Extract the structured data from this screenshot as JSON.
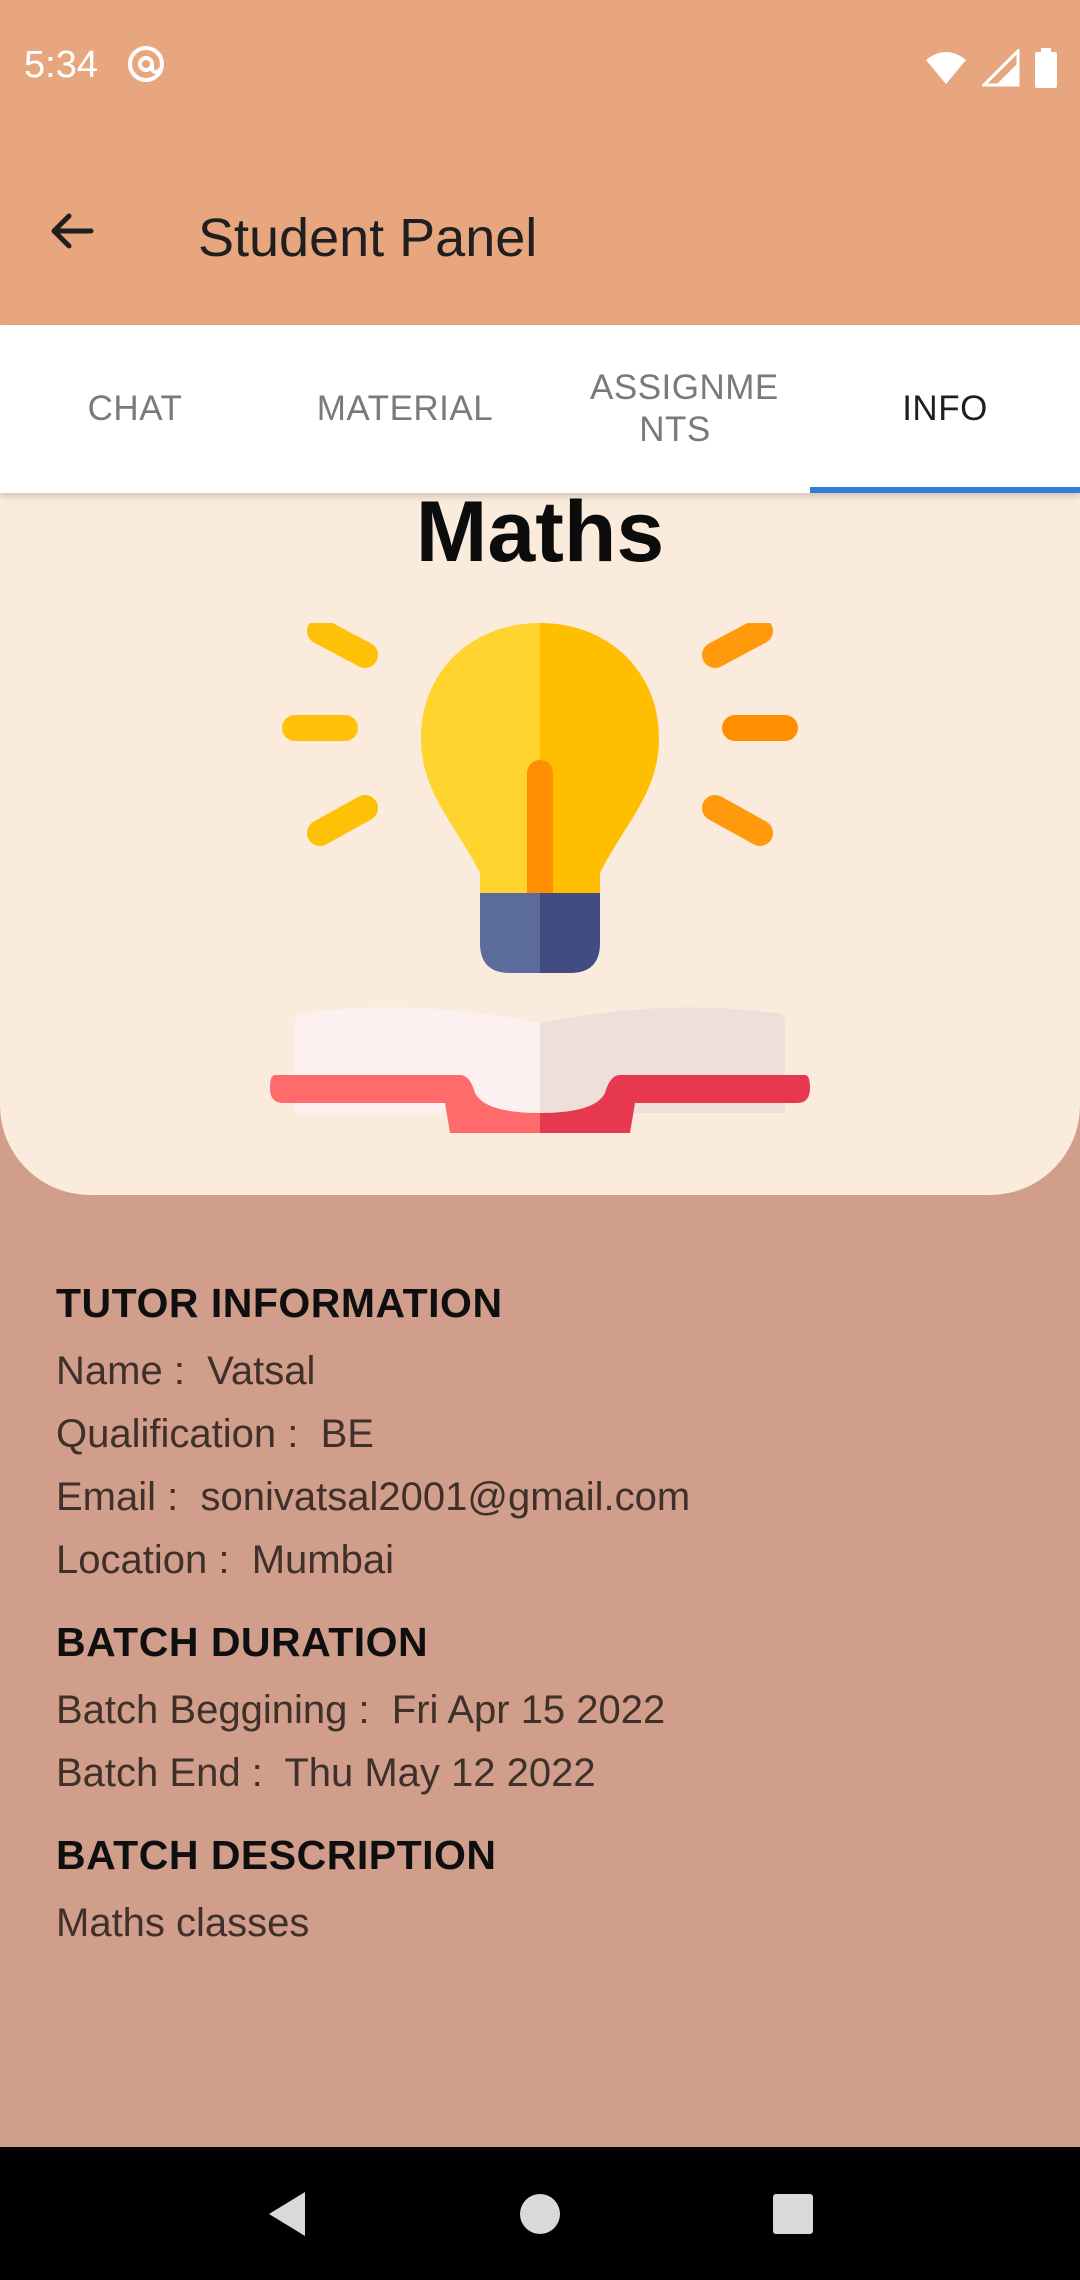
{
  "status": {
    "time": "5:34"
  },
  "app_bar": {
    "title": "Student Panel"
  },
  "tabs": [
    {
      "label": "CHAT",
      "active": false
    },
    {
      "label": "MATERIAL",
      "active": false
    },
    {
      "label": "ASSIGNME NTS",
      "active": false
    },
    {
      "label": "INFO",
      "active": true
    }
  ],
  "hero": {
    "subject": "Maths"
  },
  "tutor": {
    "heading": "TUTOR  INFORMATION",
    "name_label": "Name :  ",
    "name": "Vatsal",
    "qualification_label": "Qualification :  ",
    "qualification": "BE",
    "email_label": "Email :  ",
    "email": "sonivatsal2001@gmail.com",
    "location_label": "Location :  ",
    "location": "Mumbai"
  },
  "duration": {
    "heading": "BATCH  DURATION",
    "begin_label": "Batch Beggining :  ",
    "begin": "Fri Apr 15 2022",
    "end_label": "Batch End :  ",
    "end": "Thu May 12 2022"
  },
  "description": {
    "heading": "BATCH  DESCRIPTION",
    "text": "Maths classes"
  },
  "colors": {
    "app_bar": "#e8a67f",
    "page_bg": "#d19e8b",
    "hero_bg": "#fbebdc",
    "tab_indicator": "#2f7fd9"
  },
  "icons": [
    "back-arrow-icon",
    "at-sign-icon",
    "wifi-icon",
    "signal-icon",
    "battery-icon",
    "lightbulb-book-icon",
    "nav-back-icon",
    "nav-home-icon",
    "nav-recents-icon"
  ]
}
